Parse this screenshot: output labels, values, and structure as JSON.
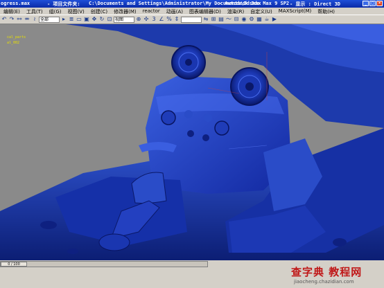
{
  "title": {
    "filename": "ogress.max",
    "project_prefix": "- 项目文件夹:",
    "project_path": "C:\\Documents and Settings\\Administrator\\My Documents\\3dsmax",
    "app": "- Autodesk 3ds Max 9 SP2",
    "display": "- 显示 : Direct 3D"
  },
  "menu": [
    "编辑(E)",
    "工具(T)",
    "组(G)",
    "视图(V)",
    "创建(C)",
    "修改器(M)",
    "reactor",
    "动画(A)",
    "图表编辑器(D)",
    "渲染(R)",
    "自定义(U)",
    "MAXScript(M)",
    "帮助(H)"
  ],
  "toolbar": {
    "selection_filter": "全部",
    "reference_coord": "视图"
  },
  "viewport": {
    "labels": [
      "cal_parts",
      "al_002"
    ]
  },
  "timeline": {
    "frame": "0 / 100"
  },
  "watermark": {
    "logo": "查字典 教程网",
    "url": "jiaocheng.chazidian.com"
  },
  "colors": {
    "model": "#1a3aa8",
    "viewport_bg": "#8a8a8a",
    "titlebar": "#0a2aa8"
  }
}
